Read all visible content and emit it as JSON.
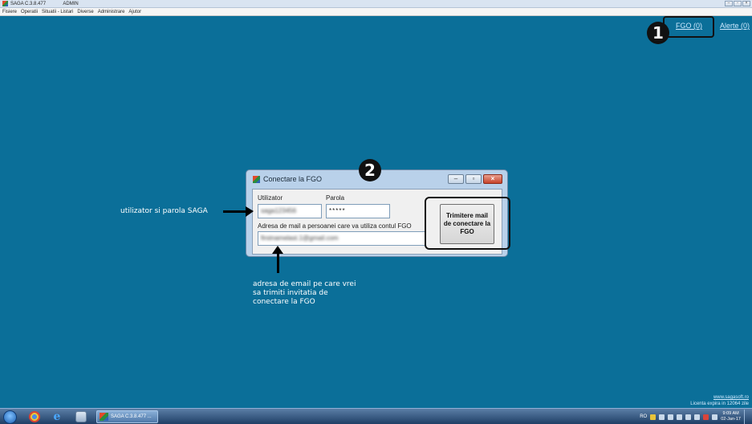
{
  "window": {
    "title": "SAGA C.3.8.477  ⁠ ⁠ ⁠ ⁠ ⁠ ⁠ ⁠ ⁠ ⁠ ⁠ ⁠ ⁠ ADMIN",
    "controls": [
      "–",
      "▫",
      "×"
    ]
  },
  "menu": {
    "items": [
      "Fisiere",
      "Operatii",
      "Situatii - Listari",
      "Diverse",
      "Administrare",
      "Ajutor"
    ]
  },
  "toplinks": {
    "fgo": "FGO (0)",
    "alerte": "Alerte (0)"
  },
  "badges": {
    "one": "1",
    "two": "2"
  },
  "dialog": {
    "title": "Conectare la FGO",
    "utilizator_label": "Utilizator",
    "parola_label": "Parola",
    "utilizator_value": "saga123456",
    "parola_value": "*****",
    "email_label": "Adresa de mail a persoanei care va utiliza contul FGO",
    "email_value": "firstnamelast.1@gmail.com",
    "send_button": "Trimitere mail de conectare la FGO",
    "controls": [
      "–",
      "▫",
      "×"
    ]
  },
  "annotations": {
    "user_pass": "utilizator si parola SAGA",
    "email": "adresa de email pe care vrei sa trimiti invitatia de conectare la FGO"
  },
  "footer": {
    "site": "www.sagasoft.ro",
    "license": "Licenta expira in 12064 zile"
  },
  "taskbar": {
    "saga_task": "SAGA C.3.8.477 ...",
    "language": "RO",
    "time": "9:09 AM",
    "date": "02-Jan-17"
  },
  "colors": {
    "desktop": "#0b6f99",
    "link": "#cfe9ff"
  }
}
